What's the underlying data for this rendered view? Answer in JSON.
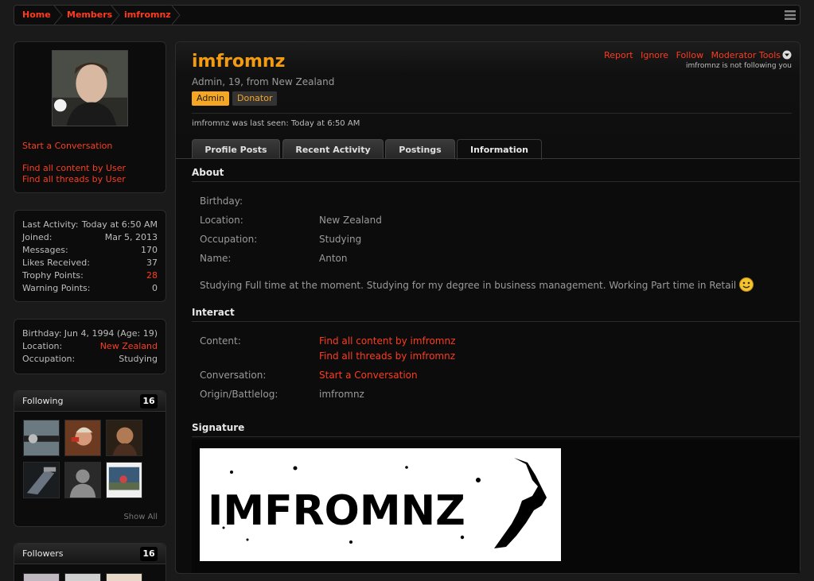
{
  "breadcrumb": {
    "items": [
      "Home",
      "Members",
      "imfromnz"
    ]
  },
  "sidebar": {
    "links": {
      "start_conversation": "Start a Conversation",
      "find_content": "Find all content by User",
      "find_threads": "Find all threads by User"
    },
    "stats": [
      {
        "label": "Last Activity:",
        "value": "Today at 6:50 AM"
      },
      {
        "label": "Joined:",
        "value": "Mar 5, 2013"
      },
      {
        "label": "Messages:",
        "value": "170"
      },
      {
        "label": "Likes Received:",
        "value": "37"
      },
      {
        "label": "Trophy Points:",
        "value": "28"
      },
      {
        "label": "Warning Points:",
        "value": "0"
      }
    ],
    "info": [
      {
        "label": "Birthday:",
        "value": "Jun 4, 1994 (Age: 19)"
      },
      {
        "label": "Location:",
        "value": "New Zealand"
      },
      {
        "label": "Occupation:",
        "value": "Studying"
      }
    ],
    "following": {
      "title": "Following",
      "count": "16",
      "show_all": "Show All"
    },
    "followers": {
      "title": "Followers",
      "count": "16"
    }
  },
  "profile": {
    "username": "imfromnz",
    "blurb": "Admin, 19, from New Zealand",
    "badges": [
      "Admin",
      "Donator"
    ],
    "last_seen_label": "imfromnz was last seen:",
    "last_seen_value": "Today at 6:50 AM",
    "actions": [
      "Report",
      "Ignore",
      "Follow",
      "Moderator Tools"
    ],
    "follow_status": "imfromnz is not following you"
  },
  "tabs": [
    "Profile Posts",
    "Recent Activity",
    "Postings",
    "Information"
  ],
  "active_tab": "Information",
  "about": {
    "heading": "About",
    "fields": [
      {
        "label": "Birthday:",
        "value": ""
      },
      {
        "label": "Location:",
        "value": "New Zealand"
      },
      {
        "label": "Occupation:",
        "value": "Studying"
      },
      {
        "label": "Name:",
        "value": "Anton"
      }
    ],
    "text": "Studying Full time at the moment. Studying for my degree in business management. Working Part time in Retail"
  },
  "interact": {
    "heading": "Interact",
    "content_label": "Content:",
    "content_links": [
      "Find all content by imfromnz",
      "Find all threads by imfromnz"
    ],
    "conversation_label": "Conversation:",
    "conversation_link": "Start a Conversation",
    "origin_label": "Origin/Battlelog:",
    "origin_value": "imfromnz"
  },
  "signature": {
    "heading": "Signature",
    "image_text": "IMFROMNZ"
  },
  "colors": {
    "accent_orange": "#f39c12",
    "link_red": "#ff3b1f",
    "bg": "#0c0c0c"
  }
}
